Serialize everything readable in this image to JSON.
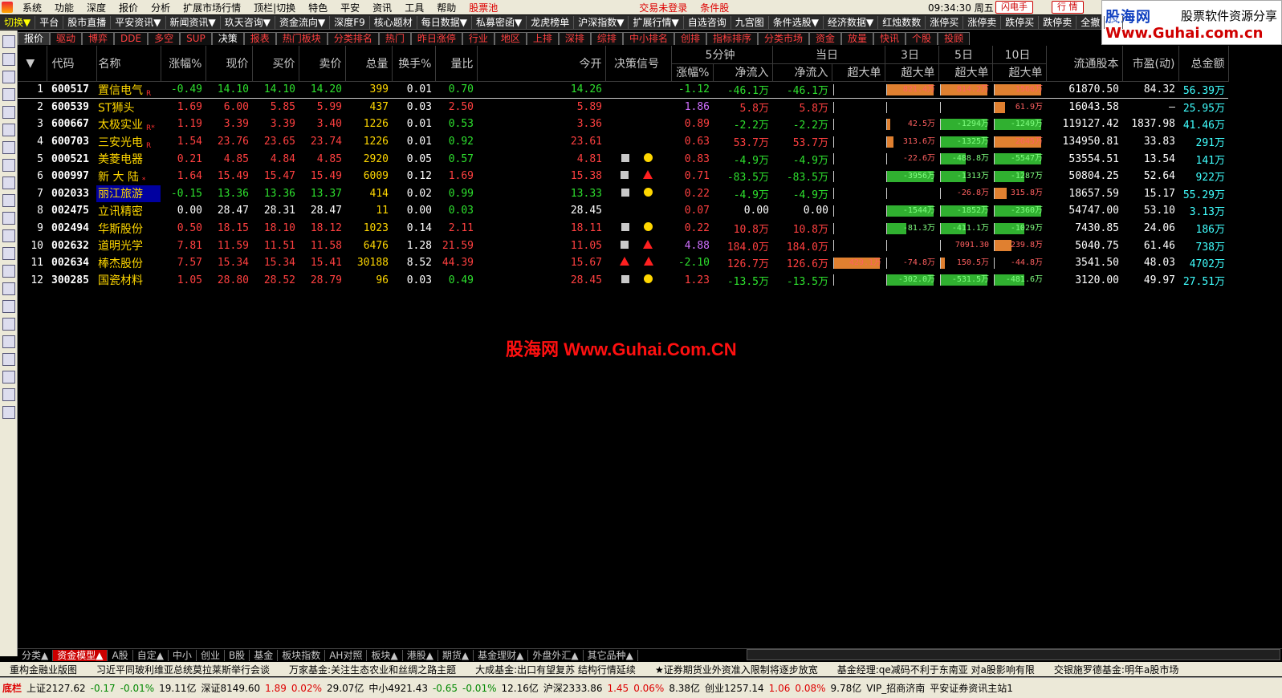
{
  "menubar": {
    "items": [
      "系统",
      "功能",
      "深度",
      "报价",
      "分析",
      "扩展市场行情",
      "顶栏|切换",
      "特色",
      "平安",
      "资讯",
      "工具",
      "帮助"
    ],
    "stock_pool": "股票池",
    "trade_status": "交易未登录",
    "cond_stock": "条件股",
    "clock": "09:34:30 周五",
    "flash": "闪电手",
    "quote": "行 情"
  },
  "brand": {
    "name": "股海网",
    "slogan": "股票软件资源分享",
    "url": "Www.Guhai.com.cn"
  },
  "toolbar": [
    "切换▼",
    "平台",
    "股市直播",
    "平安资讯▼",
    "新闻资讯▼",
    "玖天咨询▼",
    "资金流向▼",
    "深度F9",
    "核心题材",
    "每日数据▼",
    "私募密函▼",
    "龙虎榜单",
    "沪深指数▼",
    "扩展行情▼",
    "自选咨询",
    "九宫图",
    "条件选股▼",
    "经济数据▼",
    "红烛数数",
    "涨停买",
    "涨停卖",
    "跌停买",
    "跌停卖",
    "全撤",
    "预"
  ],
  "cattabs": [
    "报价",
    "驱动",
    "博弈",
    "DDE",
    "多空",
    "SUP",
    "决策",
    "报表",
    "热门板块",
    "分类排名",
    "热门",
    "昨日涨停",
    "行业",
    "地区",
    "上排",
    "深排",
    "综排",
    "中小排名",
    "创排",
    "指标排序",
    "分类市场",
    "资金",
    "放量",
    "快讯",
    "个股",
    "投顾"
  ],
  "table": {
    "headers": {
      "idx": "▼",
      "code": "代码",
      "name": "名称",
      "pct": "涨幅%",
      "price": "现价",
      "bid": "买价",
      "ask": "卖价",
      "vol": "总量",
      "turn": "换手%",
      "vr": "量比",
      "open": "今开",
      "sig": "决策信号",
      "g5": "5分钟",
      "gday": "当日",
      "g3": "3日",
      "g5d": "5日",
      "g10": "10日",
      "p5": "涨幅%",
      "nf5": "净流入",
      "nfd": "净流入",
      "xl": "超大单",
      "xl3": "超大单",
      "xl5": "超大单",
      "xl10": "超大单",
      "cap": "流通股本",
      "pe": "市盈(动)",
      "amt": "总金额"
    },
    "rows": [
      {
        "idx": "1",
        "code": "600517",
        "name": "置信电气",
        "flag": "R",
        "pct": "-0.49",
        "price": "14.10",
        "bid": "14.10",
        "ask": "14.20",
        "vol": "399",
        "turn": "0.01",
        "vr": "0.70",
        "open": "14.26",
        "s1": "",
        "s2": "",
        "p5": "-1.12",
        "nf5": "-46.1万",
        "nfd": "-46.1万",
        "xl": 0,
        "xl_l": "",
        "b3": 0.93,
        "b3c": "#e08030",
        "b3l": "821.4万",
        "b5": 0.93,
        "b5c": "#e08030",
        "b5l": "814.2万",
        "b10": 0.93,
        "b10c": "#e08030",
        "b10l": "1566万",
        "cap": "61870.50",
        "pe": "84.32",
        "amt": "56.39万"
      },
      {
        "idx": "2",
        "code": "600539",
        "name": "ST狮头",
        "flag": "",
        "pct": "1.69",
        "price": "6.00",
        "bid": "5.85",
        "ask": "5.99",
        "vol": "437",
        "turn": "0.03",
        "vr": "2.50",
        "open": "5.89",
        "s1": "",
        "s2": "",
        "p5": "1.86",
        "nf5": "5.8万",
        "nfd": "5.8万",
        "xl": 0,
        "xl_l": "",
        "b3": 0,
        "b3c": "",
        "b3l": "",
        "b5": 0,
        "b5c": "",
        "b5l": "",
        "b10": 0.22,
        "b10c": "#e08030",
        "b10l": "61.9万",
        "cap": "16043.58",
        "pe": "–",
        "amt": "25.95万"
      },
      {
        "idx": "3",
        "code": "600667",
        "name": "太极实业",
        "flag": "R*",
        "pct": "1.19",
        "price": "3.39",
        "bid": "3.39",
        "ask": "3.40",
        "vol": "1226",
        "turn": "0.01",
        "vr": "0.53",
        "open": "3.36",
        "s1": "",
        "s2": "",
        "p5": "0.89",
        "nf5": "-2.2万",
        "nfd": "-2.2万",
        "xl": 0,
        "xl_l": "",
        "b3": 0.08,
        "b3c": "#e08030",
        "b3l": "42.5万",
        "b5": 0.93,
        "b5c": "#30b030",
        "b5l": "-1294万",
        "b10": 0.93,
        "b10c": "#30b030",
        "b10l": "-1249万",
        "cap": "119127.42",
        "pe": "1837.98",
        "amt": "41.46万"
      },
      {
        "idx": "4",
        "code": "600703",
        "name": "三安光电",
        "flag": "R",
        "pct": "1.54",
        "price": "23.76",
        "bid": "23.65",
        "ask": "23.74",
        "vol": "1226",
        "turn": "0.01",
        "vr": "0.92",
        "open": "23.61",
        "s1": "",
        "s2": "",
        "p5": "0.63",
        "nf5": "53.7万",
        "nfd": "53.7万",
        "xl": 0,
        "xl_l": "",
        "b3": 0.15,
        "b3c": "#e08030",
        "b3l": "313.6万",
        "b5": 0.93,
        "b5c": "#30b030",
        "b5l": "-1325万",
        "b10": 0.93,
        "b10c": "#e08030",
        "b10l": "2645万",
        "cap": "134950.81",
        "pe": "33.83",
        "amt": "291万"
      },
      {
        "idx": "5",
        "code": "000521",
        "name": "美菱电器",
        "flag": "",
        "pct": "0.21",
        "price": "4.85",
        "bid": "4.84",
        "ask": "4.85",
        "vol": "2920",
        "turn": "0.05",
        "vr": "0.57",
        "open": "4.81",
        "s1": "sq",
        "s2": "ci",
        "p5": "0.83",
        "nf5": "-4.9万",
        "nfd": "-4.9万",
        "xl": 0,
        "xl_l": "",
        "b3": 0,
        "b3c": "",
        "b3l": "-22.6万",
        "b5": 0.5,
        "b5c": "#30b030",
        "b5l": "-488.8万",
        "b10": 0.93,
        "b10c": "#30b030",
        "b10l": "-5547万",
        "cap": "53554.51",
        "pe": "13.54",
        "amt": "141万"
      },
      {
        "idx": "6",
        "code": "000997",
        "name": "新 大 陆",
        "flag": "*",
        "pct": "1.64",
        "price": "15.49",
        "bid": "15.47",
        "ask": "15.49",
        "vol": "6009",
        "turn": "0.12",
        "vr": "1.69",
        "open": "15.38",
        "s1": "sq",
        "s2": "tr",
        "p5": "0.71",
        "nf5": "-83.5万",
        "nfd": "-83.5万",
        "xl": 0,
        "xl_l": "",
        "b3": 0.93,
        "b3c": "#30b030",
        "b3l": "-3956万",
        "b5": 0.5,
        "b5c": "#30b030",
        "b5l": "-1313万",
        "b10": 0.6,
        "b10c": "#30b030",
        "b10l": "-1287万",
        "cap": "50804.25",
        "pe": "52.64",
        "amt": "922万"
      },
      {
        "idx": "7",
        "code": "002033",
        "name": "丽江旅游",
        "flag": "",
        "pct": "-0.15",
        "price": "13.36",
        "bid": "13.36",
        "ask": "13.37",
        "vol": "414",
        "turn": "0.02",
        "vr": "0.99",
        "open": "13.33",
        "s1": "sq",
        "s2": "ci",
        "p5": "0.22",
        "nf5": "-4.9万",
        "nfd": "-4.9万",
        "xl": 0,
        "xl_l": "",
        "b3": 0,
        "b3c": "",
        "b3l": "",
        "b5": 0,
        "b5c": "",
        "b5l": "-26.8万",
        "b10": 0.25,
        "b10c": "#e08030",
        "b10l": "315.8万",
        "cap": "18657.59",
        "pe": "15.17",
        "amt": "55.29万"
      },
      {
        "idx": "8",
        "code": "002475",
        "name": "立讯精密",
        "flag": "",
        "pct": "0.00",
        "price": "28.47",
        "bid": "28.31",
        "ask": "28.47",
        "vol": "11",
        "turn": "0.00",
        "vr": "0.03",
        "open": "28.45",
        "s1": "",
        "s2": "",
        "p5": "0.07",
        "nf5": "0.00",
        "nfd": "0.00",
        "xl": 0,
        "xl_l": "",
        "b3": 0.93,
        "b3c": "#30b030",
        "b3l": "-1544万",
        "b5": 0.93,
        "b5c": "#30b030",
        "b5l": "-1852万",
        "b10": 0.93,
        "b10c": "#30b030",
        "b10l": "-2360万",
        "cap": "54747.00",
        "pe": "53.10",
        "amt": "3.13万"
      },
      {
        "idx": "9",
        "code": "002494",
        "name": "华斯股份",
        "flag": "",
        "pct": "0.50",
        "price": "18.15",
        "bid": "18.10",
        "ask": "18.12",
        "vol": "1023",
        "turn": "0.14",
        "vr": "2.11",
        "open": "18.11",
        "s1": "sq",
        "s2": "ci",
        "p5": "0.22",
        "nf5": "10.8万",
        "nfd": "10.8万",
        "xl": 0,
        "xl_l": "",
        "b3": 0.4,
        "b3c": "#30b030",
        "b3l": "-81.3万",
        "b5": 0.5,
        "b5c": "#30b030",
        "b5l": "-411.1万",
        "b10": 0.6,
        "b10c": "#30b030",
        "b10l": "-1029万",
        "cap": "7430.85",
        "pe": "24.06",
        "amt": "186万"
      },
      {
        "idx": "10",
        "code": "002632",
        "name": "道明光学",
        "flag": "",
        "pct": "7.81",
        "price": "11.59",
        "bid": "11.51",
        "ask": "11.58",
        "vol": "6476",
        "turn": "1.28",
        "vr": "21.59",
        "open": "11.05",
        "s1": "sq",
        "s2": "tr",
        "p5": "4.88",
        "nf5": "184.0万",
        "nfd": "184.0万",
        "xl": 0,
        "xl_l": "",
        "b3": 0,
        "b3c": "",
        "b3l": "",
        "b5": 0,
        "b5c": "",
        "b5l": "7091.30",
        "b10": 0.35,
        "b10c": "#e08030",
        "b10l": "239.8万",
        "cap": "5040.75",
        "pe": "61.46",
        "amt": "738万"
      },
      {
        "idx": "11",
        "code": "002634",
        "name": "棒杰股份",
        "flag": "",
        "pct": "7.57",
        "price": "15.34",
        "bid": "15.34",
        "ask": "15.41",
        "vol": "30188",
        "turn": "8.52",
        "vr": "44.39",
        "open": "15.67",
        "s1": "tr",
        "s2": "tr",
        "p5": "-2.10",
        "nf5": "126.7万",
        "nfd": "126.6万",
        "xl": 0.93,
        "xl_l": "429.1万",
        "b3": 0,
        "b3c": "",
        "b3l": "-74.8万",
        "b5": 0.1,
        "b5c": "#e08030",
        "b5l": "150.5万",
        "b10": 0,
        "b10c": "",
        "b10l": "-44.8万",
        "cap": "3541.50",
        "pe": "48.03",
        "amt": "4702万"
      },
      {
        "idx": "12",
        "code": "300285",
        "name": "国瓷材料",
        "flag": "",
        "pct": "1.05",
        "price": "28.80",
        "bid": "28.52",
        "ask": "28.79",
        "vol": "96",
        "turn": "0.03",
        "vr": "0.49",
        "open": "28.45",
        "s1": "sq",
        "s2": "ci",
        "p5": "1.23",
        "nf5": "-13.5万",
        "nfd": "-13.5万",
        "xl": 0,
        "xl_l": "",
        "b3": 0.93,
        "b3c": "#30b030",
        "b3l": "-302.0万",
        "b5": 0.93,
        "b5c": "#30b030",
        "b5l": "-531.5万",
        "b10": 0.6,
        "b10c": "#30b030",
        "b10l": "-481.6万",
        "cap": "3120.00",
        "pe": "49.97",
        "amt": "27.51万"
      }
    ]
  },
  "watermark": "股海网 Www.Guhai.Com.CN",
  "bottomtabs": [
    "分类▲",
    "资金模型▲",
    "A股",
    "自定▲",
    "中小",
    "创业",
    "B股",
    "基金",
    "板块指数",
    "AH对照",
    "板块▲",
    "港股▲",
    "期货▲",
    "基金理财▲",
    "外盘外汇▲",
    "其它品种▲"
  ],
  "news": [
    "重构金融业版图",
    "习近平同玻利维亚总统莫拉莱斯举行会谈",
    "万家基金:关注生态农业和丝绸之路主题",
    "大成基金:出口有望复苏 结构行情延续",
    "★证券期货业外资准入限制将逐步放宽",
    "基金经理:qe减码不利于东南亚 对a股影响有限",
    "交银施罗德基金:明年a股市场"
  ],
  "status": [
    {
      "t": "底栏",
      "c": "#d00"
    },
    {
      "t": "上证2127.62",
      "c": "#000"
    },
    {
      "t": "-0.17",
      "c": "#080"
    },
    {
      "t": "-0.01%",
      "c": "#080"
    },
    {
      "t": "19.11亿",
      "c": "#000"
    },
    {
      "t": "深证8149.60",
      "c": "#000"
    },
    {
      "t": "1.89",
      "c": "#d00"
    },
    {
      "t": "0.02%",
      "c": "#d00"
    },
    {
      "t": "29.07亿",
      "c": "#000"
    },
    {
      "t": "中小4921.43",
      "c": "#000"
    },
    {
      "t": "-0.65",
      "c": "#080"
    },
    {
      "t": "-0.01%",
      "c": "#080"
    },
    {
      "t": "12.16亿",
      "c": "#000"
    },
    {
      "t": "沪深2333.86",
      "c": "#000"
    },
    {
      "t": "1.45",
      "c": "#d00"
    },
    {
      "t": "0.06%",
      "c": "#d00"
    },
    {
      "t": "8.38亿",
      "c": "#000"
    },
    {
      "t": "创业1257.14",
      "c": "#000"
    },
    {
      "t": "1.06",
      "c": "#d00"
    },
    {
      "t": "0.08%",
      "c": "#d00"
    },
    {
      "t": "9.78亿",
      "c": "#000"
    },
    {
      "t": "VIP_招商济南",
      "c": "#000"
    },
    {
      "t": "平安证券资讯主站1",
      "c": "#000"
    }
  ]
}
